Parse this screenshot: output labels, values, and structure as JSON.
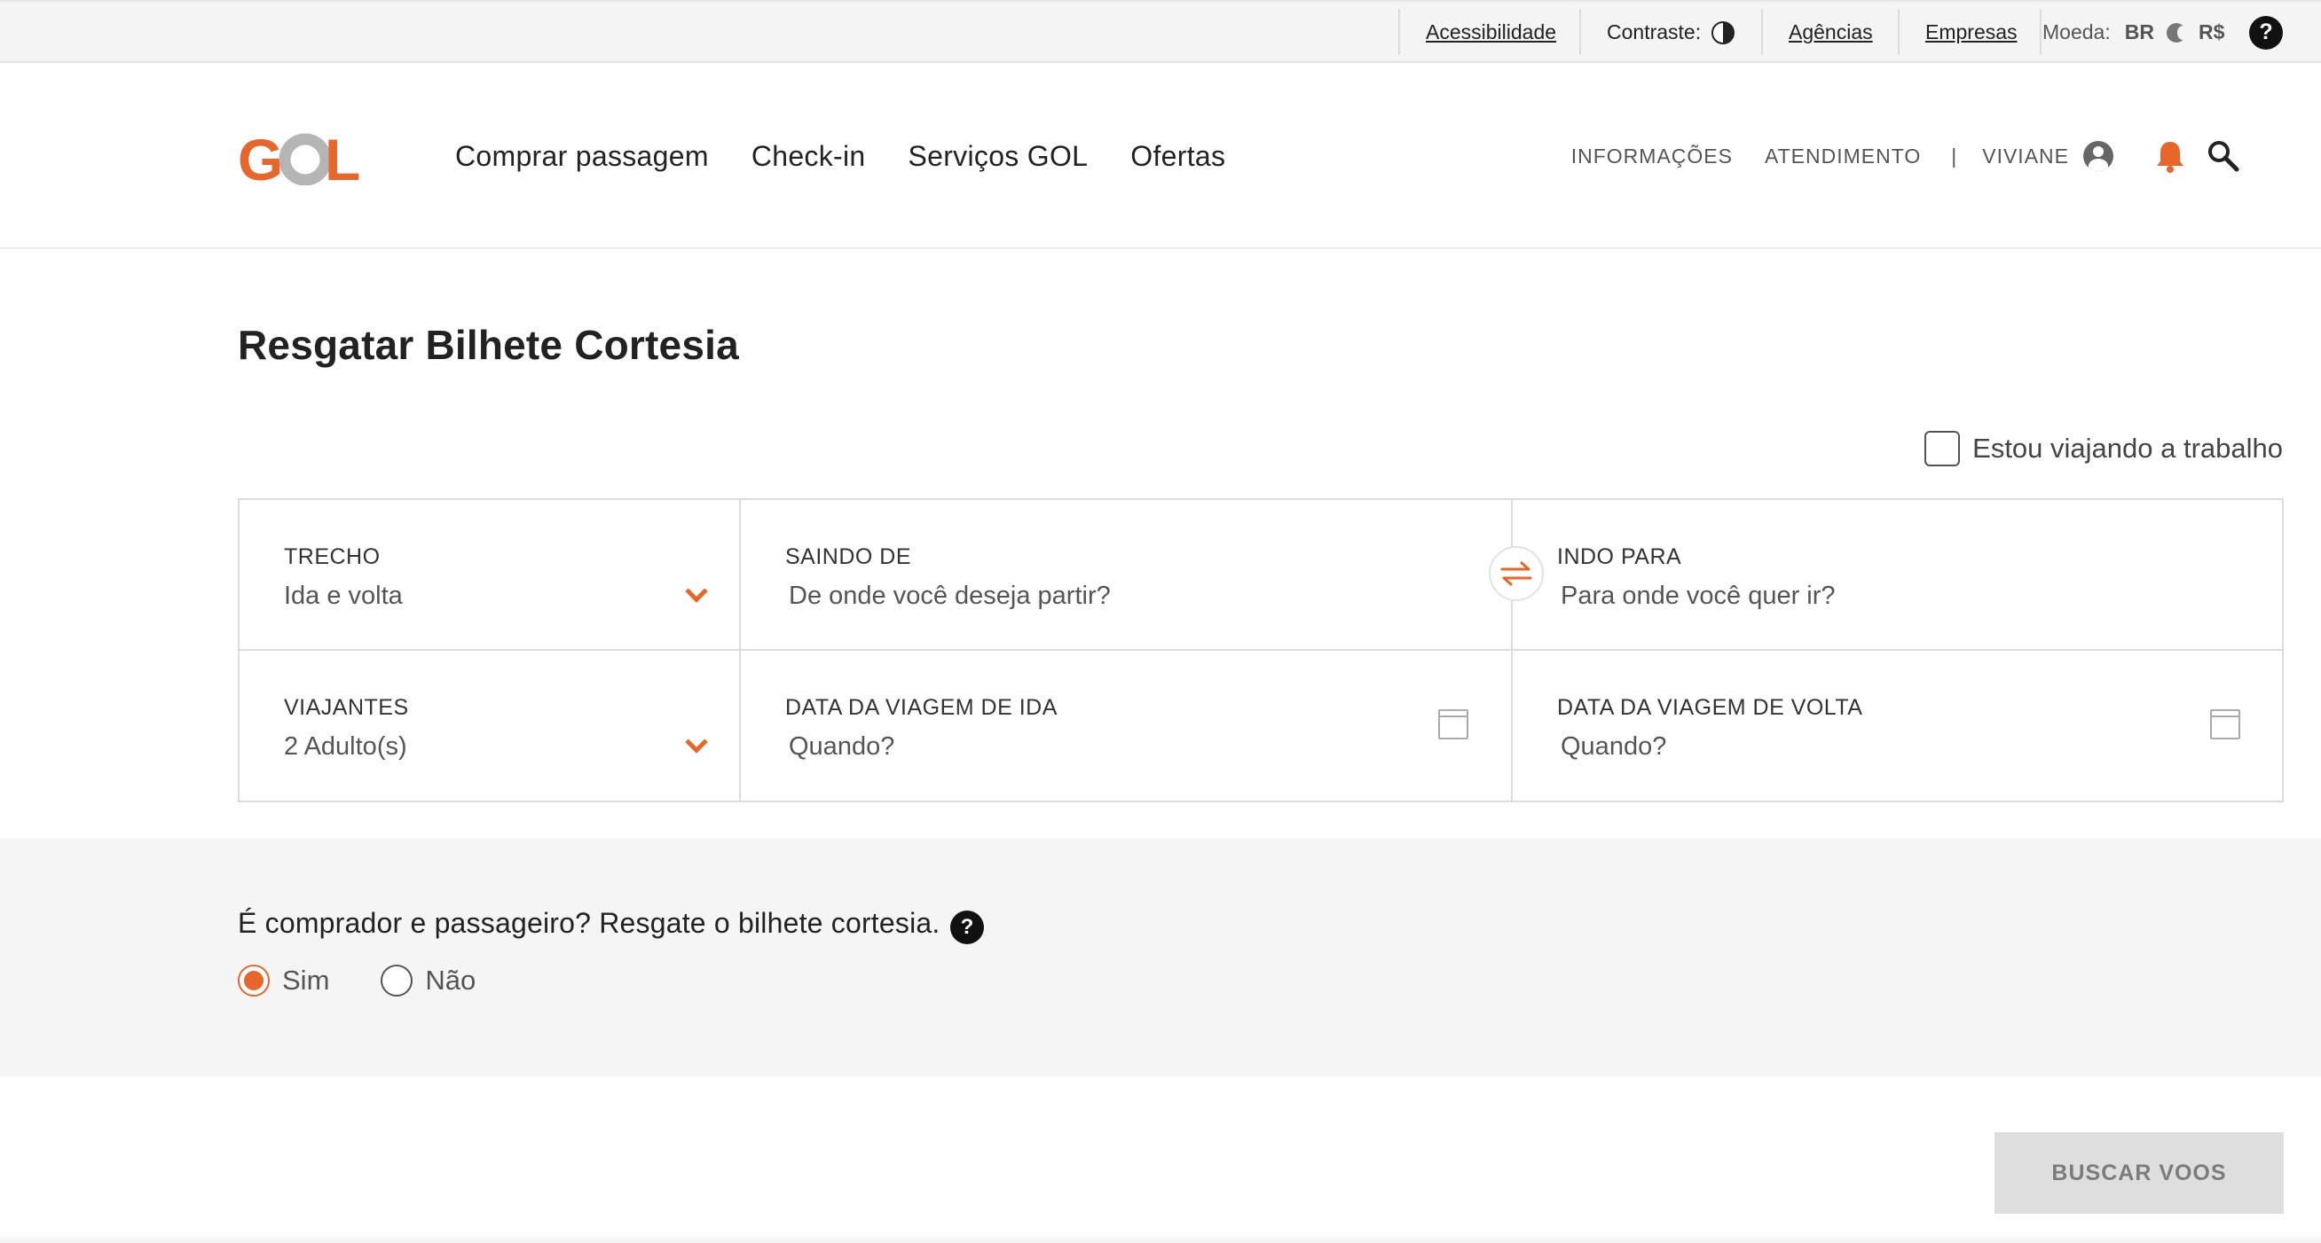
{
  "utility": {
    "accessibility": "Acessibilidade",
    "contrast_label": "Contraste:",
    "agencies": "Agências",
    "companies": "Empresas",
    "currency_label": "Moeda:",
    "currency_country": "BR",
    "currency_symbol": "R$",
    "help": "?"
  },
  "header": {
    "logo_text": "GOL",
    "nav": [
      "Comprar passagem",
      "Check-in",
      "Serviços GOL",
      "Ofertas"
    ],
    "info": "INFORMAÇÕES",
    "support": "ATENDIMENTO",
    "divider": "|",
    "user_name": "VIVIANE"
  },
  "page": {
    "title": "Resgatar Bilhete Cortesia",
    "work_travel_label": "Estou viajando a trabalho",
    "work_travel_checked": false
  },
  "form": {
    "trecho": {
      "label": "TRECHO",
      "value": "Ida e volta"
    },
    "origin": {
      "label": "SAINDO DE",
      "placeholder": "De onde você deseja partir?"
    },
    "destination": {
      "label": "INDO PARA",
      "placeholder": "Para onde você quer ir?"
    },
    "travelers": {
      "label": "VIAJANTES",
      "value": "2 Adulto(s)"
    },
    "depart_date": {
      "label": "DATA DA VIAGEM DE IDA",
      "placeholder": "Quando?"
    },
    "return_date": {
      "label": "DATA DA VIAGEM DE VOLTA",
      "placeholder": "Quando?"
    }
  },
  "courtesy": {
    "question": "É comprador e passageiro? Resgate o bilhete cortesia.",
    "help": "?",
    "options": [
      "Sim",
      "Não"
    ],
    "selected": "Sim"
  },
  "actions": {
    "search": "BUSCAR VOOS"
  },
  "colors": {
    "brand_orange": "#e8662a",
    "logo_grey": "#b5b5b5"
  }
}
